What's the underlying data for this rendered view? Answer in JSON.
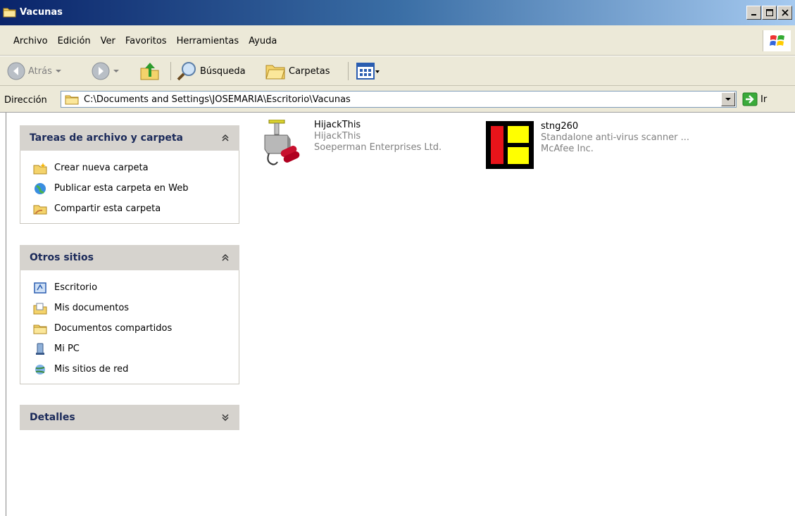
{
  "window": {
    "title": "Vacunas"
  },
  "menu": [
    "Archivo",
    "Edición",
    "Ver",
    "Favoritos",
    "Herramientas",
    "Ayuda"
  ],
  "toolbar": {
    "back": "Atrás",
    "search": "Búsqueda",
    "folders": "Carpetas"
  },
  "address": {
    "label": "Dirección",
    "path": "C:\\Documents and Settings\\JOSEMARIA\\Escritorio\\Vacunas",
    "go": "Ir"
  },
  "tasks_panel": {
    "title": "Tareas de archivo y carpeta",
    "items": [
      "Crear nueva carpeta",
      "Publicar esta carpeta en Web",
      "Compartir esta carpeta"
    ]
  },
  "places_panel": {
    "title": "Otros sitios",
    "items": [
      "Escritorio",
      "Mis documentos",
      "Documentos compartidos",
      "Mi PC",
      "Mis sitios de red"
    ]
  },
  "details_panel": {
    "title": "Detalles"
  },
  "files": [
    {
      "name": "HijackThis",
      "description": "HijackThis",
      "company": "Soeperman Enterprises Ltd."
    },
    {
      "name": "stng260",
      "description": "Standalone anti-virus scanner ...",
      "company": "McAfee Inc."
    }
  ]
}
